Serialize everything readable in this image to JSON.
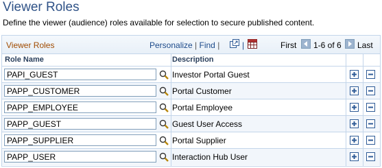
{
  "page": {
    "title": "Viewer Roles",
    "description": "Define the viewer (audience) roles available for selection to secure published content."
  },
  "grid": {
    "title": "Viewer Roles",
    "personalize_label": "Personalize",
    "find_label": "Find",
    "first_label": "First",
    "range_label": "1-6 of 6",
    "last_label": "Last",
    "icons": [
      "view-all-icon",
      "download-icon",
      "prev-arrow-icon",
      "next-arrow-icon"
    ],
    "columns": [
      "Role Name",
      "Description"
    ],
    "rows": [
      {
        "role": "PAPI_GUEST",
        "description": "Investor Portal Guest"
      },
      {
        "role": "PAPP_CUSTOMER",
        "description": "Portal Customer"
      },
      {
        "role": "PAPP_EMPLOYEE",
        "description": "Portal Employee"
      },
      {
        "role": "PAPP_GUEST",
        "description": "Guest User Access"
      },
      {
        "role": "PAPP_SUPPLIER",
        "description": "Portal Supplier"
      },
      {
        "role": "PAPP_USER",
        "description": "Interaction Hub User"
      }
    ]
  },
  "colors": {
    "title": "#2f5287",
    "grid_title": "#a04b00",
    "link": "#1c4a8a",
    "border": "#c3d5ea"
  }
}
